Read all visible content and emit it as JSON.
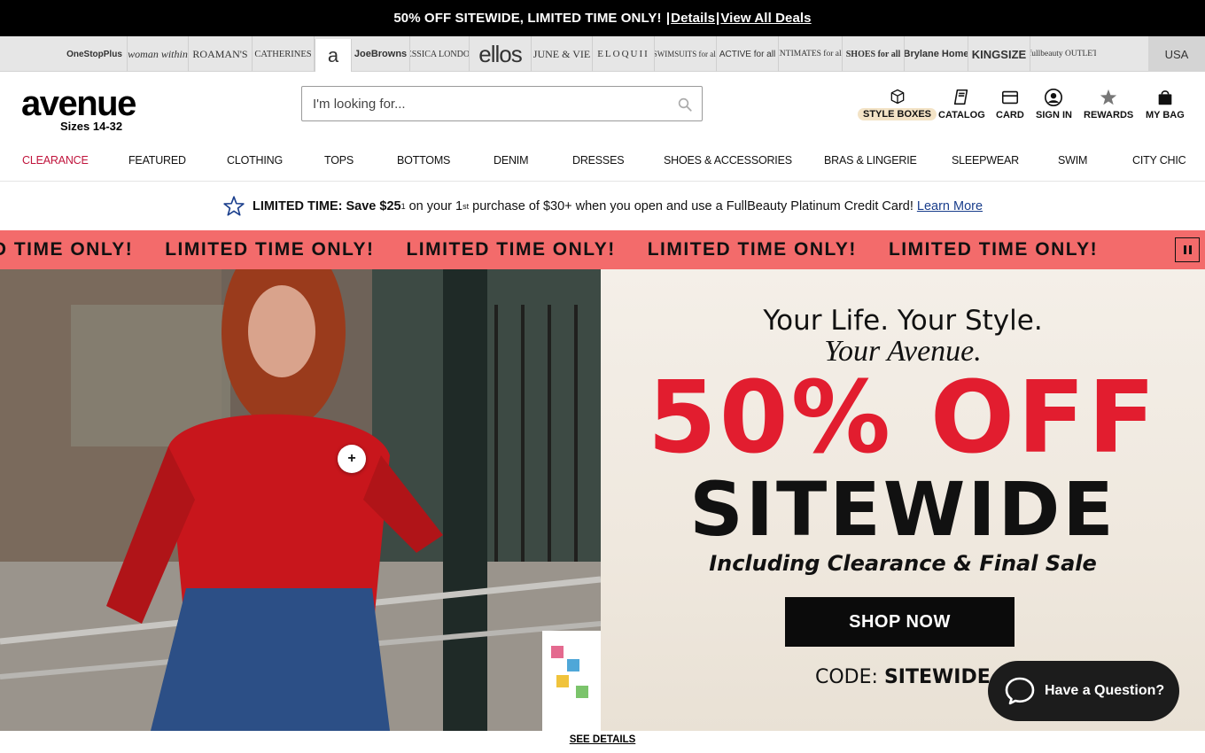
{
  "promo_bar": {
    "text": "50% OFF SITEWIDE, LIMITED TIME ONLY!",
    "details_link": "Details",
    "deals_link": "View All Deals"
  },
  "brands": [
    "OneStopPlus",
    "woman within",
    "ROAMAN'S",
    "CATHERINES",
    "a",
    "JoeBrowns",
    "JESSICA LONDON",
    "ellos",
    "JUNE & VIE",
    "ELOQUII",
    "SWIMSUITS for all",
    "ACTIVE for all",
    "INTIMATES for all",
    "SHOES for all",
    "Brylane Home",
    "KINGSIZE",
    "fullbeauty OUTLET"
  ],
  "region": "USA",
  "logo": {
    "name": "avenue",
    "sub": "Sizes 14-32"
  },
  "search": {
    "placeholder": "I'm looking for..."
  },
  "utility": {
    "style_boxes": "STYLE BOXES",
    "catalog": "CATALOG",
    "card": "CARD",
    "sign_in": "SIGN IN",
    "rewards": "REWARDS",
    "bag": "MY BAG"
  },
  "nav": [
    "CLEARANCE",
    "FEATURED",
    "CLOTHING",
    "TOPS",
    "BOTTOMS",
    "DENIM",
    "DRESSES",
    "SHOES & ACCESSORIES",
    "BRAS & LINGERIE",
    "SLEEPWEAR",
    "SWIM",
    "CITY CHIC"
  ],
  "credit_banner": {
    "bold": "LIMITED TIME: Save $25",
    "sup1": "1",
    "text1": " on your 1",
    "sup2": "st",
    "text2": " purchase of $30+ when you open and use a FullBeauty Platinum Credit Card!",
    "link": "Learn More"
  },
  "ticker": [
    "LIMITED TIME ONLY!",
    "LIMITED TIME ONLY!",
    "LIMITED TIME ONLY!",
    "LIMITED TIME ONLY!",
    "LIMITED TIME ONLY!"
  ],
  "hero": {
    "tagline1": "Your Life. Your Style.",
    "tagline2": "Your Avenue.",
    "headline": "50% OFF",
    "subheadline": "SITEWIDE",
    "including": "Including Clearance & Final Sale",
    "cta": "SHOP NOW",
    "code_label": "CODE: ",
    "code_value": "SITEWIDE",
    "hotspot": "+"
  },
  "chat": {
    "label": "Have a Question?"
  },
  "see_details": "SEE DETAILS"
}
